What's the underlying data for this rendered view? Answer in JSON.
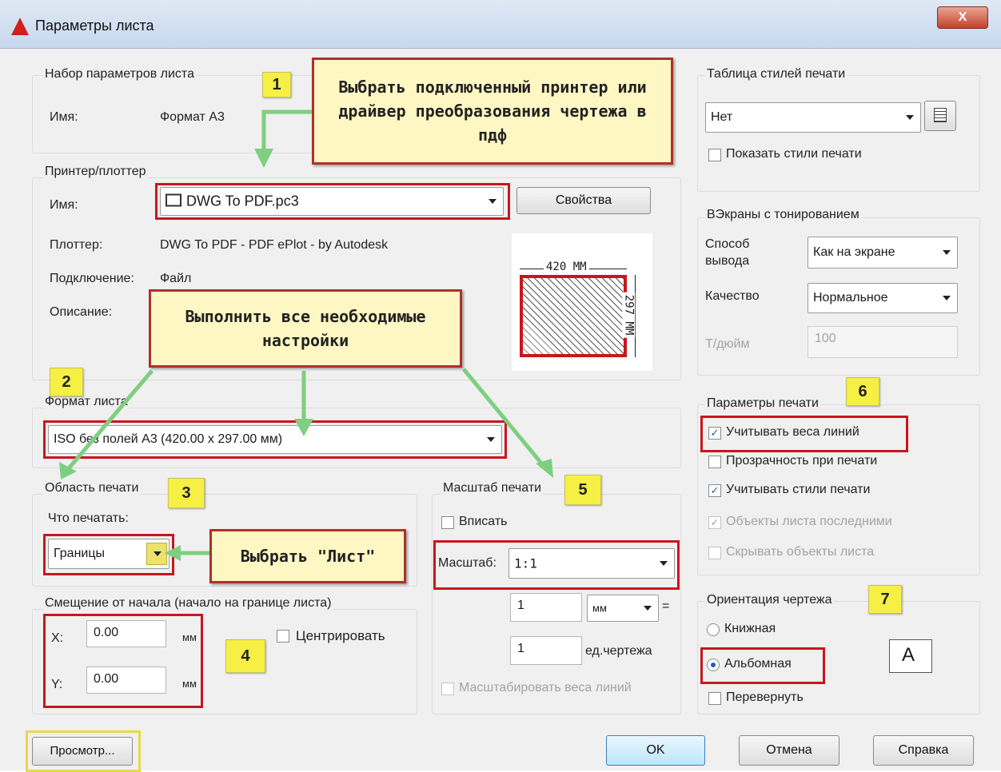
{
  "window": {
    "title": "Параметры листа",
    "close_label": "X"
  },
  "page_setup": {
    "group_title": "Набор параметров листа",
    "name_label": "Имя:",
    "name_value": "Формат А3"
  },
  "printer": {
    "group_title": "Принтер/плоттер",
    "name_label": "Имя:",
    "name_value": "DWG To PDF.pc3",
    "properties_button": "Свойства",
    "plotter_label": "Плоттер:",
    "plotter_value": "DWG To PDF - PDF ePlot - by Autodesk",
    "connection_label": "Подключение:",
    "connection_value": "Файл",
    "description_label": "Описание:",
    "preview": {
      "width_label": "420 ММ",
      "height_label": "297 ММ"
    }
  },
  "paper_size": {
    "group_title": "Формат листа",
    "value": "ISO без полей А3 (420.00 х 297.00 мм)"
  },
  "plot_area": {
    "group_title": "Область печати",
    "what_label": "Что печатать:",
    "what_value": "Границы"
  },
  "offset": {
    "group_title": "Смещение от начала (начало на границе листа)",
    "x_label": "X:",
    "x_value": "0.00",
    "x_unit": "мм",
    "y_label": "Y:",
    "y_value": "0.00",
    "y_unit": "мм",
    "center_label": "Центрировать"
  },
  "scale": {
    "group_title": "Масштаб печати",
    "fit_label": "Вписать",
    "scale_label": "Масштаб:",
    "scale_value": "1:1",
    "value1": "1",
    "unit_value": "мм",
    "equals": "=",
    "value2": "1",
    "unit2_label": "ед.чертежа",
    "lineweights_label": "Масштабировать веса линий"
  },
  "plot_style": {
    "group_title": "Таблица стилей печати",
    "value": "Нет",
    "show_label": "Показать стили печати"
  },
  "shaded": {
    "group_title": "ВЭкраны с тонированием",
    "output_label": "Способ вывода",
    "output_value": "Как на экране",
    "quality_label": "Качество",
    "quality_value": "Нормальное",
    "dpi_label": "Т/дюйм",
    "dpi_value": "100"
  },
  "plot_options": {
    "group_title": "Параметры печати",
    "items": [
      {
        "label": "Учитывать веса линий",
        "checked": "✓"
      },
      {
        "label": "Прозрачность при печати",
        "checked": ""
      },
      {
        "label": "Учитывать стили печати",
        "checked": "✓"
      },
      {
        "label": "Объекты листа последними",
        "checked": "✓"
      },
      {
        "label": "Скрывать объекты листа",
        "checked": ""
      }
    ]
  },
  "orientation": {
    "group_title": "Ориентация чертежа",
    "portrait_label": "Книжная",
    "landscape_label": "Альбомная",
    "upside_down_label": "Перевернуть",
    "icon_letter": "A"
  },
  "buttons": {
    "preview": "Просмотр...",
    "ok": "OK",
    "cancel": "Отмена",
    "help": "Справка"
  },
  "annotations": {
    "callout_printer": "Выбрать подключенный принтер или драйвер преобразования чертежа в пдф",
    "callout_settings": "Выполнить все необходимые настройки",
    "callout_sheet": "Выбрать \"Лист\"",
    "num1": "1",
    "num2": "2",
    "num3": "3",
    "num4": "4",
    "num5": "5",
    "num6": "6",
    "num7": "7"
  }
}
